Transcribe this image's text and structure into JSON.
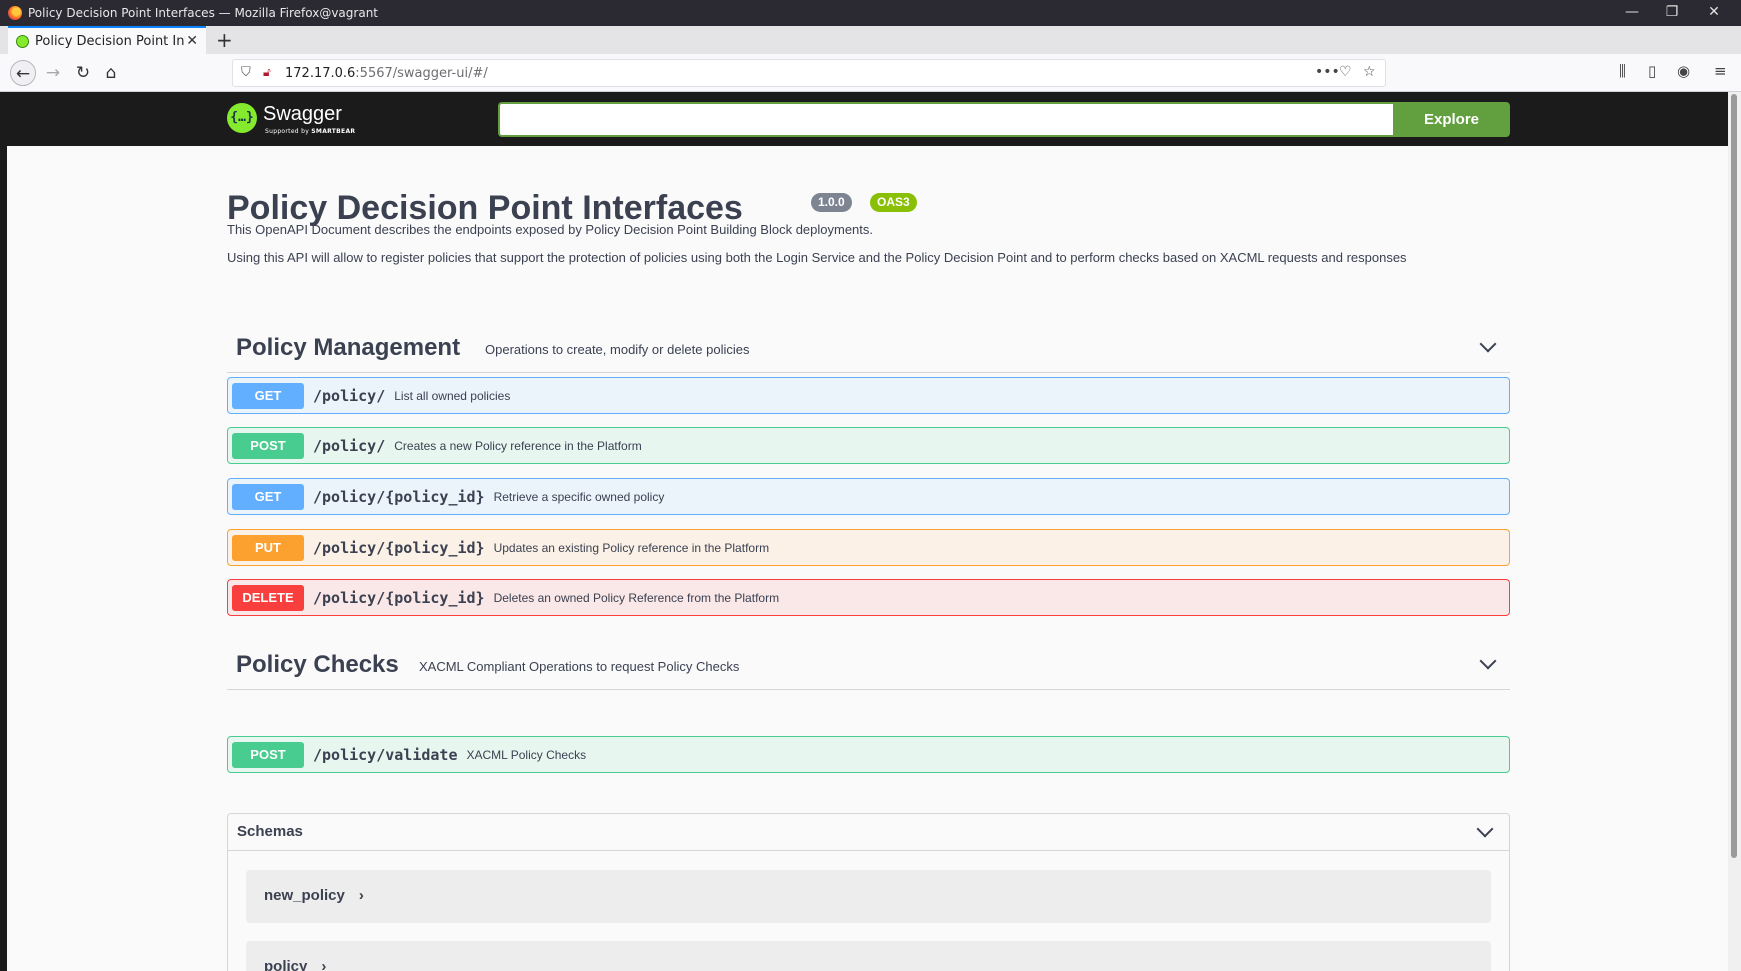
{
  "window": {
    "title": "Policy Decision Point Interfaces — Mozilla Firefox@vagrant",
    "minimize": "—",
    "restore": "❐",
    "close": "✕"
  },
  "tab": {
    "title": "Policy Decision Point Inte",
    "close": "✕",
    "new_tab": "+"
  },
  "nav": {
    "back": "←",
    "forward": "→",
    "reload": "↻",
    "home": "⌂",
    "url_host": "172.17.0.6",
    "url_path": ":5567/swagger-ui/#/",
    "more": "•••",
    "pocket": "♡",
    "bookmark": "☆",
    "library": "⫼",
    "sidebar": "▯",
    "account": "◉",
    "menu": "≡"
  },
  "swagger": {
    "logo_mark": "{…}",
    "logo_text": "Swagger",
    "logo_sub_prefix": "Supported by ",
    "logo_sub_brand": "SMARTBEAR",
    "explore_value": "",
    "explore_label": "Explore"
  },
  "info": {
    "title": "Policy Decision Point Interfaces",
    "version": "1.0.0",
    "oas": "OAS3",
    "description_1": "This OpenAPI Document describes the endpoints exposed by Policy Decision Point Building Block deployments.",
    "description_2": "Using this API will allow to register policies that support the protection of policies using both the Login Service and the Policy Decision Point and to perform checks based on XACML requests and responses"
  },
  "tags": [
    {
      "name": "Policy Management",
      "description": "Operations to create, modify or delete policies",
      "operations": [
        {
          "method": "GET",
          "path": "/policy/",
          "summary": "List all owned policies"
        },
        {
          "method": "POST",
          "path": "/policy/",
          "summary": "Creates a new Policy reference in the Platform"
        },
        {
          "method": "GET",
          "path": "/policy/{policy_id}",
          "summary": "Retrieve a specific owned policy"
        },
        {
          "method": "PUT",
          "path": "/policy/{policy_id}",
          "summary": "Updates an existing Policy reference in the Platform"
        },
        {
          "method": "DELETE",
          "path": "/policy/{policy_id}",
          "summary": "Deletes an owned Policy Reference from the Platform"
        }
      ]
    },
    {
      "name": "Policy Checks",
      "description": "XACML Compliant Operations to request Policy Checks",
      "operations": [
        {
          "method": "POST",
          "path": "/policy/validate",
          "summary": "XACML Policy Checks"
        }
      ]
    }
  ],
  "schemas": {
    "title": "Schemas",
    "models": [
      {
        "name": "new_policy",
        "arrow": "›"
      },
      {
        "name": "policy",
        "arrow": "›"
      }
    ]
  }
}
